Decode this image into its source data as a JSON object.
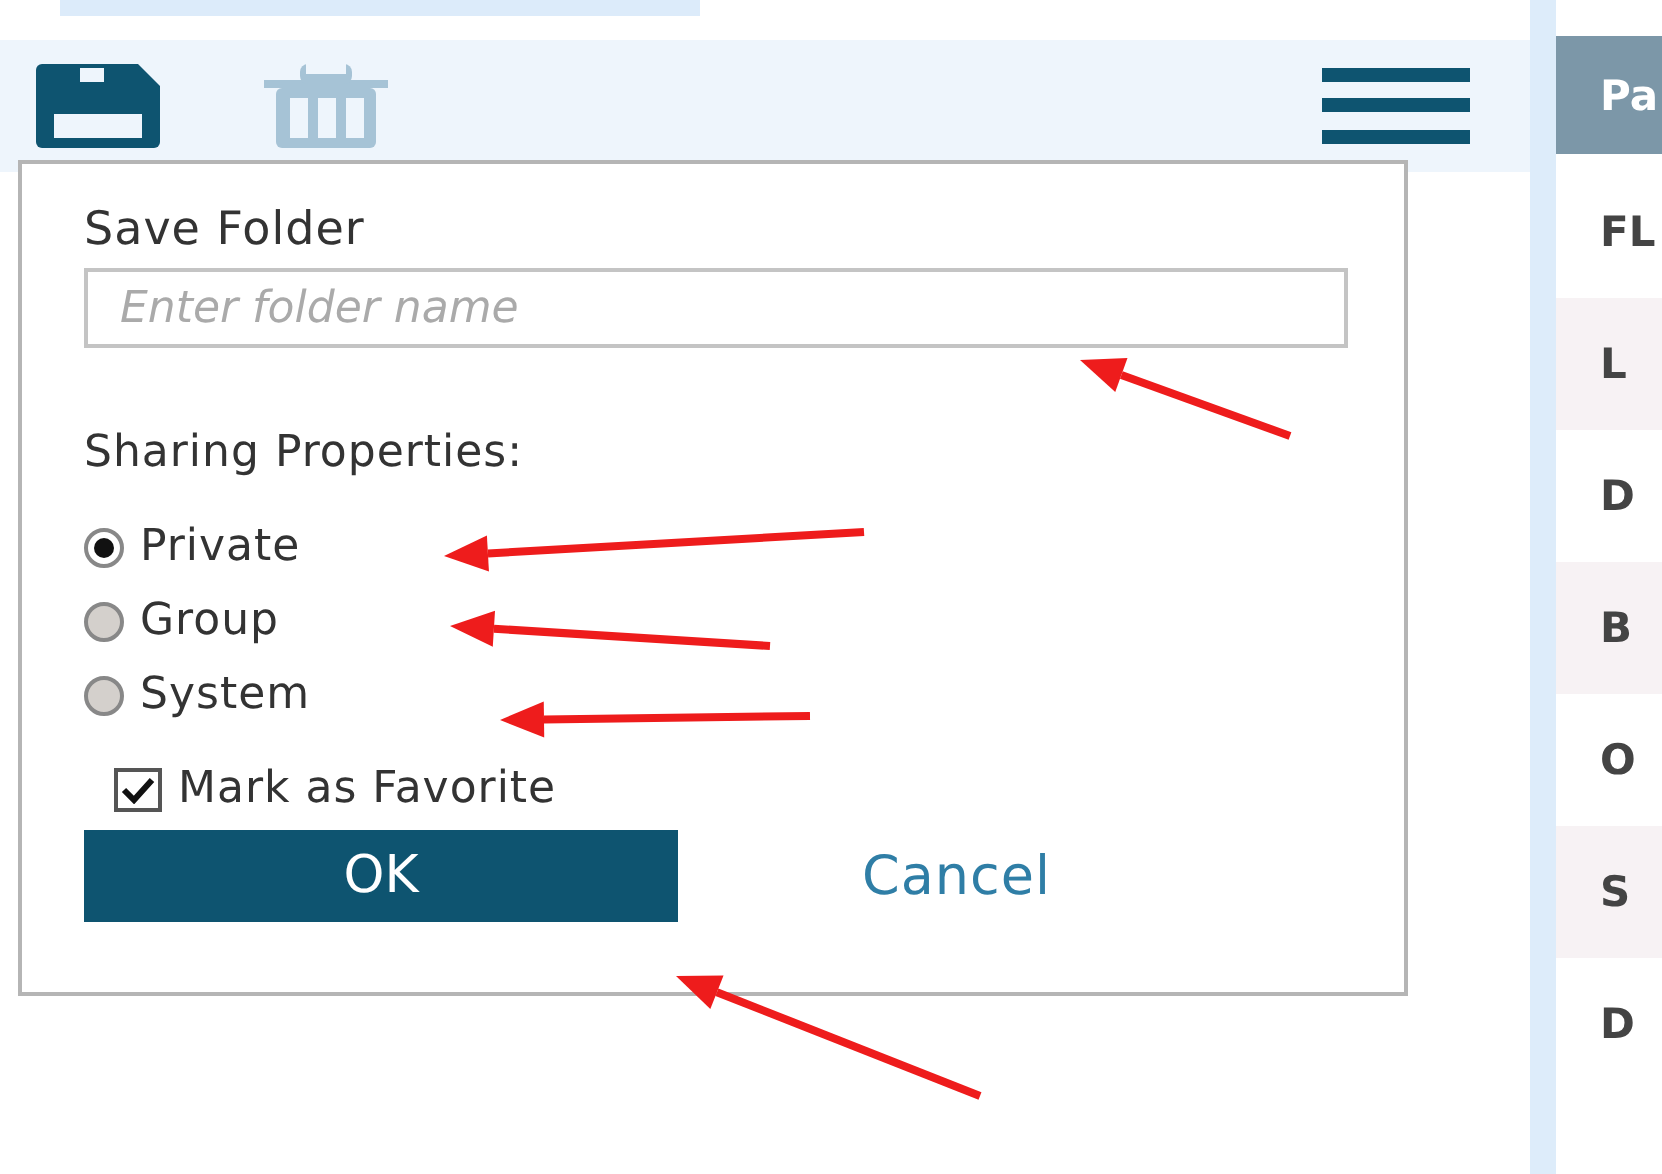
{
  "toolbar": {
    "save_enabled": true,
    "delete_enabled": false
  },
  "dialog": {
    "title": "Save Folder",
    "input": {
      "placeholder": "Enter folder name"
    },
    "sharing_label": "Sharing Properties:",
    "options": [
      {
        "label": "Private",
        "selected": true
      },
      {
        "label": "Group",
        "selected": false
      },
      {
        "label": "System",
        "selected": false
      }
    ],
    "favorite": {
      "label": "Mark as Favorite",
      "checked": true
    },
    "ok": "OK",
    "cancel": "Cancel"
  },
  "table": {
    "header": "Pa",
    "rows": [
      "FL",
      "L",
      "D",
      "B",
      "O",
      "S",
      "D"
    ]
  }
}
